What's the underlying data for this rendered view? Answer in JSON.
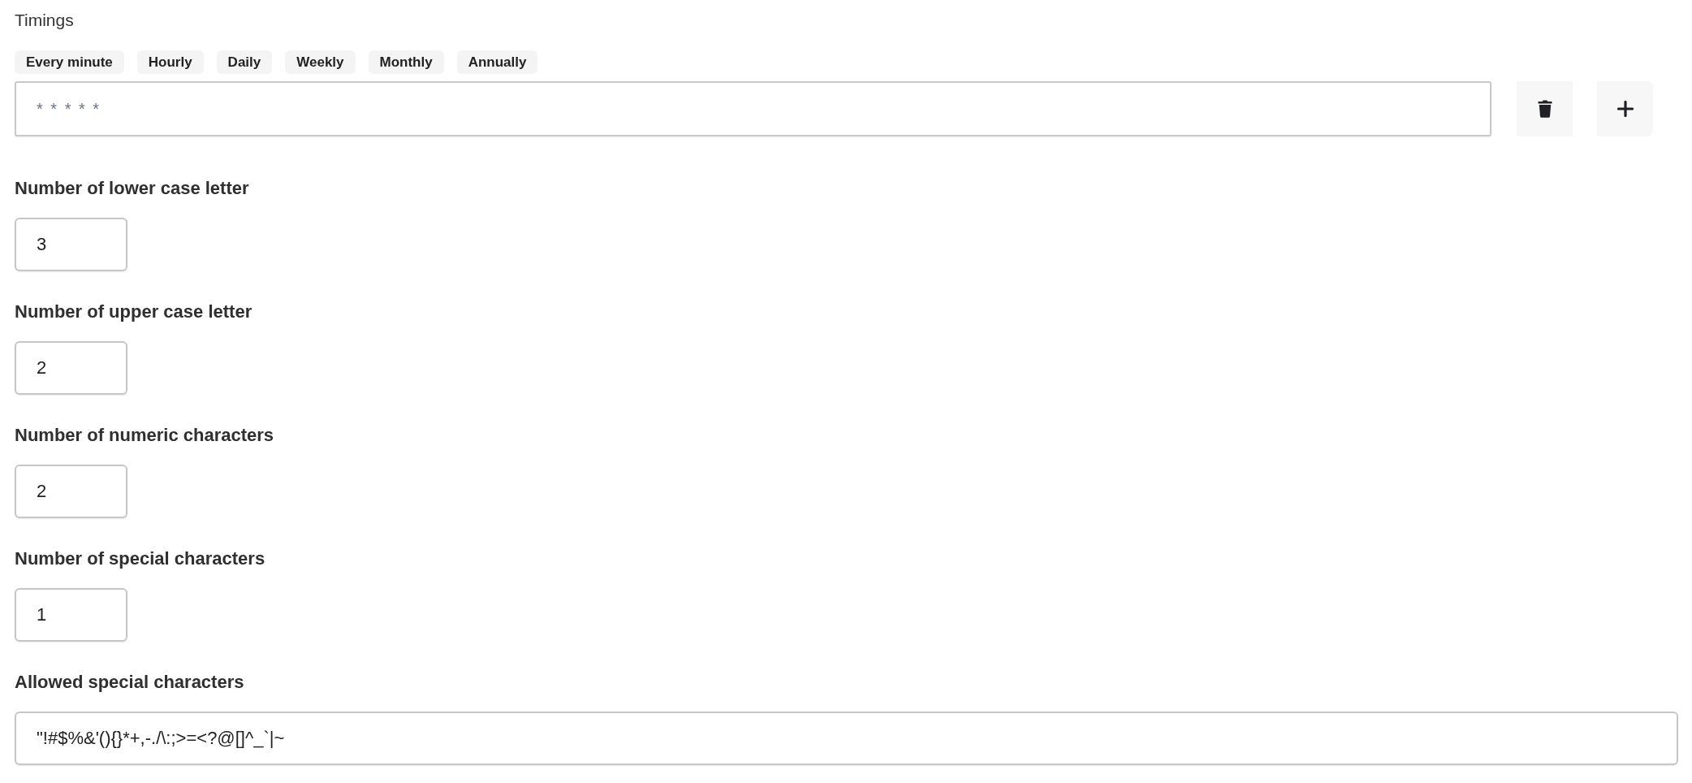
{
  "timings": {
    "label": "Timings",
    "presets": [
      {
        "label": "Every minute"
      },
      {
        "label": "Hourly"
      },
      {
        "label": "Daily"
      },
      {
        "label": "Weekly"
      },
      {
        "label": "Monthly"
      },
      {
        "label": "Annually"
      }
    ],
    "cron_field": {
      "placeholder": "* * * * *"
    }
  },
  "fields": [
    {
      "kind": "number",
      "label": "Number of lower case letter",
      "value": "3"
    },
    {
      "kind": "number",
      "label": "Number of upper case letter",
      "value": "2"
    },
    {
      "kind": "number",
      "label": "Number of numeric characters",
      "value": "2"
    },
    {
      "kind": "number",
      "label": "Number of special characters",
      "value": "1"
    },
    {
      "kind": "text",
      "label": "Allowed special characters",
      "value": "\"!#$%&'(){}*+,-./\\:;>=<?@[]^_`|~"
    }
  ]
}
